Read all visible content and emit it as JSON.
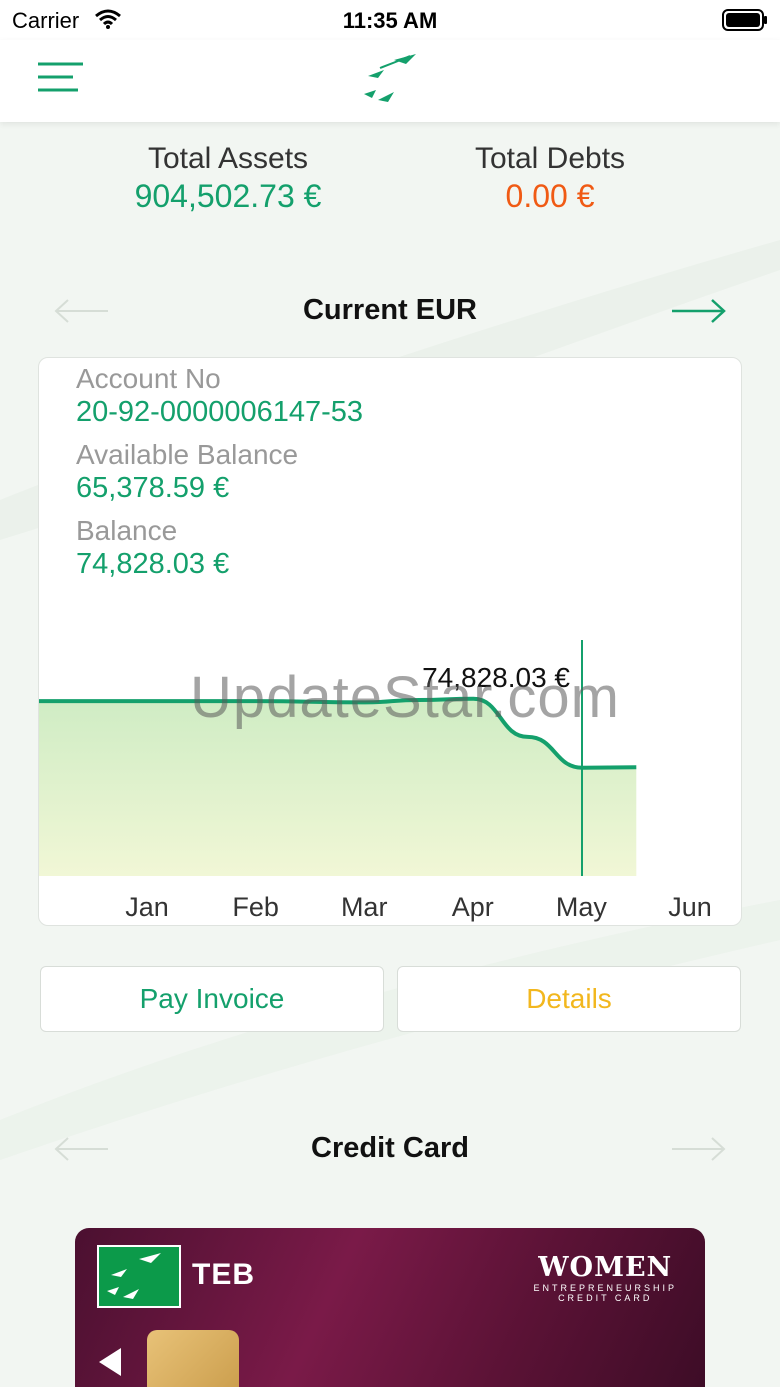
{
  "status_bar": {
    "carrier": "Carrier",
    "time": "11:35 AM"
  },
  "summary": {
    "assets_label": "Total Assets",
    "assets_value": "904,502.73 €",
    "debts_label": "Total Debts",
    "debts_value": "0.00 €"
  },
  "account": {
    "title": "Current EUR",
    "account_no_label": "Account No",
    "account_no": "20-92-0000006147-53",
    "available_label": "Available Balance",
    "available_value": "65,378.59 €",
    "balance_label": "Balance",
    "balance_value": "74,828.03 €"
  },
  "actions": {
    "pay_invoice": "Pay Invoice",
    "details": "Details"
  },
  "credit_card": {
    "title": "Credit Card",
    "brand": "TEB",
    "product_line1": "WOMEN",
    "product_line2": "ENTREPRENEURSHIP",
    "product_line3": "CREDIT CARD"
  },
  "watermark": "UpdateStar.com",
  "colors": {
    "green": "#14a06c",
    "orange": "#f05a14",
    "yellow": "#f2b71e"
  },
  "chart_data": {
    "type": "area",
    "categories": [
      "Jan",
      "Feb",
      "Mar",
      "Apr",
      "May",
      "Jun"
    ],
    "x": [
      0.0,
      1.0,
      2.0,
      3.0,
      3.5,
      4.0,
      4.5,
      5.0,
      5.5
    ],
    "y": [
      86000,
      86000,
      86000,
      85800,
      86200,
      86400,
      80000,
      74828.03,
      74900
    ],
    "ylim": [
      60000,
      105000
    ],
    "highlight_label": "74,828.03 €",
    "highlight_x": 5.0
  }
}
